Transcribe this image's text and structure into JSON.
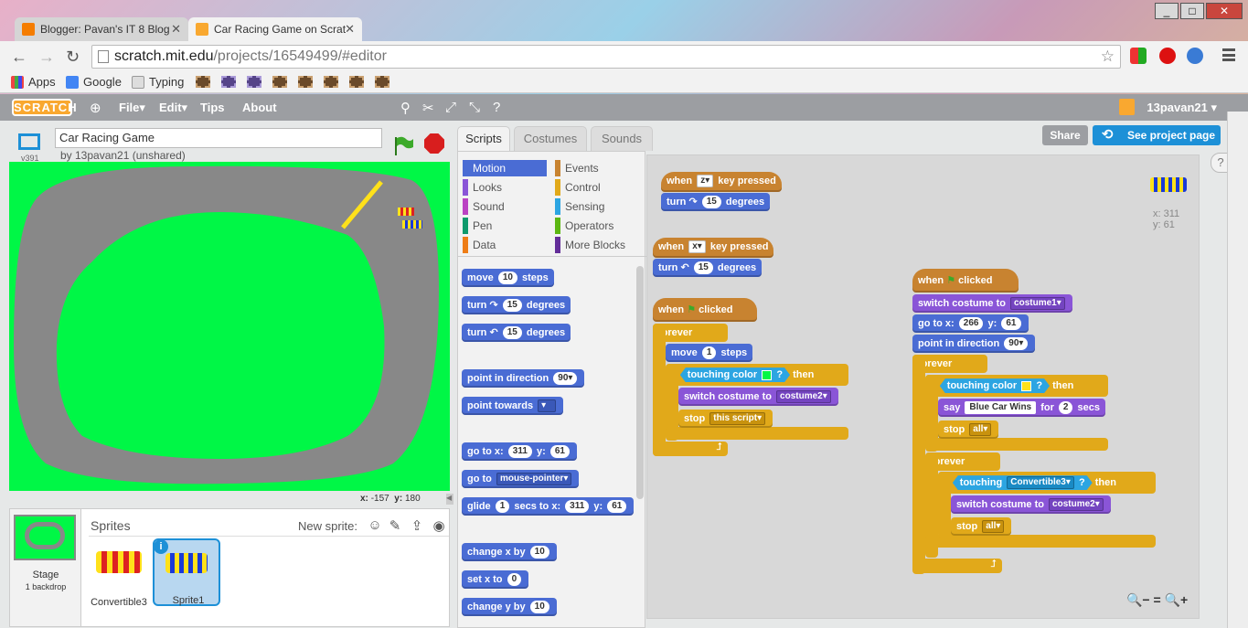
{
  "browser": {
    "window_controls": [
      "_",
      "□",
      "✕"
    ],
    "tabs": [
      {
        "label": "Blogger: Pavan's IT 8 Blog",
        "icon": "blogger-icon",
        "active": false
      },
      {
        "label": "Car Racing Game on Scrat",
        "icon": "scratch-favicon-icon",
        "active": true
      }
    ],
    "url_host": "scratch.mit.edu",
    "url_path": "/projects/16549499/#editor",
    "bookmarks": [
      {
        "label": "Apps",
        "icon": "apps-icon"
      },
      {
        "label": "Google",
        "icon": "google-icon"
      },
      {
        "label": "Typing",
        "icon": "page-icon"
      }
    ]
  },
  "scratch": {
    "logo": "SCRATCH",
    "menu": [
      "File▾",
      "Edit▾",
      "Tips",
      "About"
    ],
    "user": "13pavan21 ▾",
    "project_title": "Car Racing Game",
    "byline": "by 13pavan21 (unshared)",
    "version": "v391",
    "share_label": "Share",
    "see_project_label": "See project page",
    "tabs": [
      "Scripts",
      "Costumes",
      "Sounds"
    ],
    "mouse_x_label": "x:",
    "mouse_x": "-157",
    "mouse_y_label": "y:",
    "mouse_y": "180",
    "sprites_header": "Sprites",
    "new_sprite_label": "New sprite:",
    "stage_label": "Stage",
    "stage_sub": "1 backdrop",
    "sprite_list": [
      "Convertible3",
      "Sprite1"
    ],
    "info_label": "i",
    "categories_left": [
      "Motion",
      "Looks",
      "Sound",
      "Pen",
      "Data"
    ],
    "categories_right": [
      "Events",
      "Control",
      "Sensing",
      "Operators",
      "More Blocks"
    ],
    "category_colors": {
      "Motion": "#4a6cd4",
      "Looks": "#8a55d7",
      "Sound": "#bb42c3",
      "Pen": "#0e9a6c",
      "Data": "#ee7d16",
      "Events": "#c88330",
      "Control": "#e1a91a",
      "Sensing": "#2ca5e2",
      "Operators": "#5cb712",
      "More Blocks": "#632d99"
    },
    "palette": {
      "move": "move",
      "move_n": "10",
      "steps": "steps",
      "turn": "turn",
      "turn_cw_n": "15",
      "turn_ccw_n": "15",
      "degrees": "degrees",
      "point_dir": "point in direction",
      "point_dir_n": "90▾",
      "point_towards": "point towards",
      "goto_xy": "go to x:",
      "goto_x": "311",
      "y_label": "y:",
      "goto_y": "61",
      "goto": "go to",
      "goto_target": "mouse-pointer▾",
      "glide": "glide",
      "glide_n": "1",
      "glide_secs": "secs to x:",
      "glide_x": "311",
      "glide_y": "61",
      "change_x": "change x by",
      "change_x_n": "10",
      "set_x": "set x to",
      "set_x_n": "0",
      "change_y": "change y by",
      "change_y_n": "10"
    },
    "scripts": {
      "when": "when",
      "key_pressed": "key pressed",
      "key_z": "z▾",
      "key_x": "x▾",
      "clicked": "clicked",
      "turn": "turn",
      "n15": "15",
      "degrees": "degrees",
      "forever": "forever",
      "move": "move",
      "move_n": "1",
      "steps": "steps",
      "if": "if",
      "then": "then",
      "touching_color": "touching color",
      "q": "?",
      "switch_costume": "switch costume to",
      "costume2": "costume2▾",
      "costume1": "costume1▾",
      "stop": "stop",
      "this_script": "this script▾",
      "all": "all▾",
      "goto_x": "go to x:",
      "x266": "266",
      "y_label": "y:",
      "y61": "61",
      "point_dir": "point in direction",
      "dir90": "90▾",
      "say": "say",
      "say_text": "Blue Car Wins",
      "for": "for",
      "secs_n": "2",
      "secs": "secs",
      "touching": "touching",
      "convertible3": "Convertible3▾",
      "sprite_x_label": "x:",
      "sprite_x": "311",
      "sprite_y_label": "y:",
      "sprite_y": "61",
      "zoom_out": "🔍−",
      "zoom_reset": "=",
      "zoom_in": "🔍+"
    }
  }
}
